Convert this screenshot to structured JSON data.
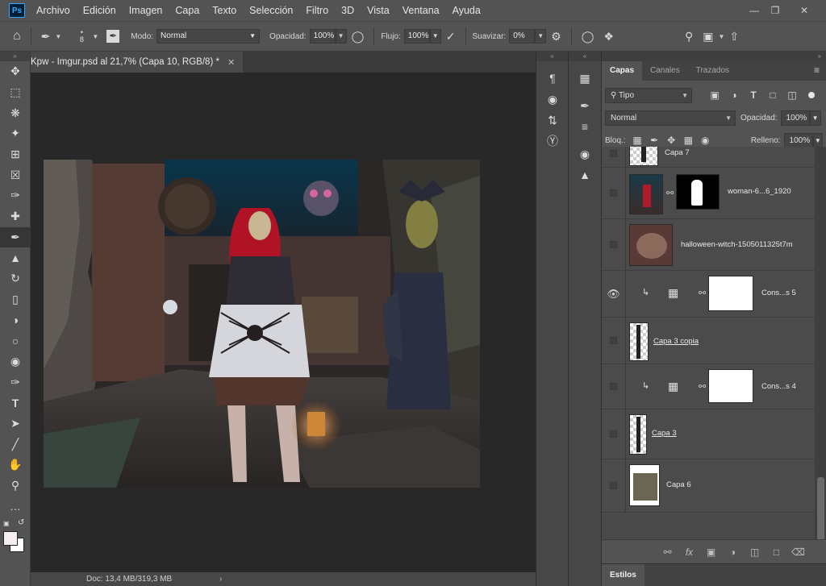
{
  "menubar": {
    "items": [
      "Archivo",
      "Edición",
      "Imagen",
      "Capa",
      "Texto",
      "Selección",
      "Filtro",
      "3D",
      "Vista",
      "Ventana",
      "Ayuda"
    ],
    "logo": "Ps"
  },
  "options": {
    "brush_size": "8",
    "modo_label": "Modo:",
    "modo_value": "Normal",
    "opacidad_label": "Opacidad:",
    "opacidad_value": "100%",
    "flujo_label": "Flujo:",
    "flujo_value": "100%",
    "suavizar_label": "Suavizar:",
    "suavizar_value": "0%"
  },
  "document": {
    "tab_title": "Kpw - Imgur.psd al 21,7% (Capa 10, RGB/8) *",
    "status": "Doc: 13,4 MB/319,3 MB"
  },
  "layers_panel": {
    "tabs": [
      "Capas",
      "Canales",
      "Trazados"
    ],
    "filter_value": "Tipo",
    "blend_mode": "Normal",
    "opacidad_label": "Opacidad:",
    "opacidad_value": "100%",
    "bloq_label": "Bloq.:",
    "relleno_label": "Relleno:",
    "relleno_value": "100%",
    "layers": [
      {
        "name": "Capa 7",
        "visible": false
      },
      {
        "name": "woman-6...6_1920",
        "visible": false
      },
      {
        "name": "halloween-witch-1505011325t7m",
        "visible": false
      },
      {
        "name": "Cons...s 5",
        "visible": true
      },
      {
        "name": "Capa 3 copia",
        "visible": false
      },
      {
        "name": "Cons...s 4",
        "visible": false
      },
      {
        "name": "Capa 3",
        "visible": false
      },
      {
        "name": "Capa 6",
        "visible": false
      }
    ],
    "styles_tab": "Estilos"
  },
  "icons": {
    "move": "move-icon",
    "marquee": "marquee-icon",
    "lasso": "lasso-icon",
    "wand": "magic-wand-icon",
    "crop": "crop-icon",
    "frame": "frame-icon",
    "eyedropper": "eyedropper-icon",
    "heal": "healing-icon",
    "brush": "brush-icon",
    "stamp": "stamp-icon",
    "history": "history-brush-icon",
    "eraser": "eraser-icon",
    "bucket": "paint-bucket-icon",
    "dodge": "dodge-icon",
    "sponge": "sponge-icon",
    "pen": "pen-icon",
    "text": "type-icon",
    "select": "path-select-icon",
    "line": "line-icon",
    "hand": "hand-icon",
    "zoom": "zoom-icon",
    "more": "more-icon"
  },
  "colors": {
    "accent": "#31a8ff",
    "panel": "#535353",
    "canvas_bg": "#282828"
  }
}
